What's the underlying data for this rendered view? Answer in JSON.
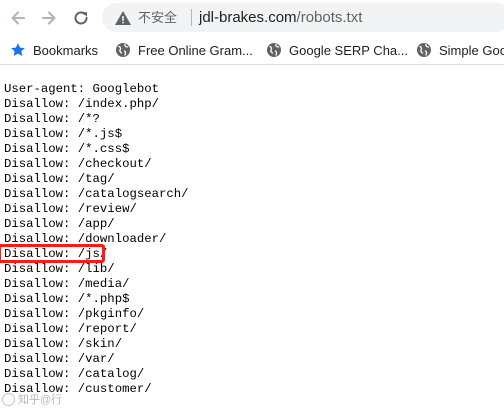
{
  "toolbar": {
    "back_icon": "arrow-left-icon",
    "forward_icon": "arrow-right-icon",
    "reload_icon": "reload-icon",
    "security_icon": "warning-triangle-icon",
    "security_label": "不安全",
    "url_host": "jdl-brakes.com",
    "url_path": "/robots.txt"
  },
  "bookmarks": [
    {
      "label": "Bookmarks",
      "icon": "star-icon"
    },
    {
      "label": "Free Online Gram...",
      "icon": "globe-icon"
    },
    {
      "label": "Google SERP Cha...",
      "icon": "globe-icon"
    },
    {
      "label": "Simple Goo",
      "icon": "globe-icon"
    }
  ],
  "content": {
    "lines": [
      "User-agent: Googlebot",
      "Disallow: /index.php/",
      "Disallow: /*?",
      "Disallow: /*.js$",
      "Disallow: /*.css$",
      "Disallow: /checkout/",
      "Disallow: /tag/",
      "Disallow: /catalogsearch/",
      "Disallow: /review/",
      "Disallow: /app/",
      "Disallow: /downloader/",
      "Disallow: /js/",
      "Disallow: /lib/",
      "Disallow: /media/",
      "Disallow: /*.php$",
      "Disallow: /pkginfo/",
      "Disallow: /report/",
      "Disallow: /skin/",
      "Disallow: /var/",
      "Disallow: /catalog/",
      "Disallow: /customer/"
    ],
    "highlighted_line": "Disallow: /js/"
  },
  "colors": {
    "highlight": "#ff1a1a",
    "bookmark_star": "#1a73e8"
  },
  "watermark": {
    "text": "知乎@行"
  }
}
